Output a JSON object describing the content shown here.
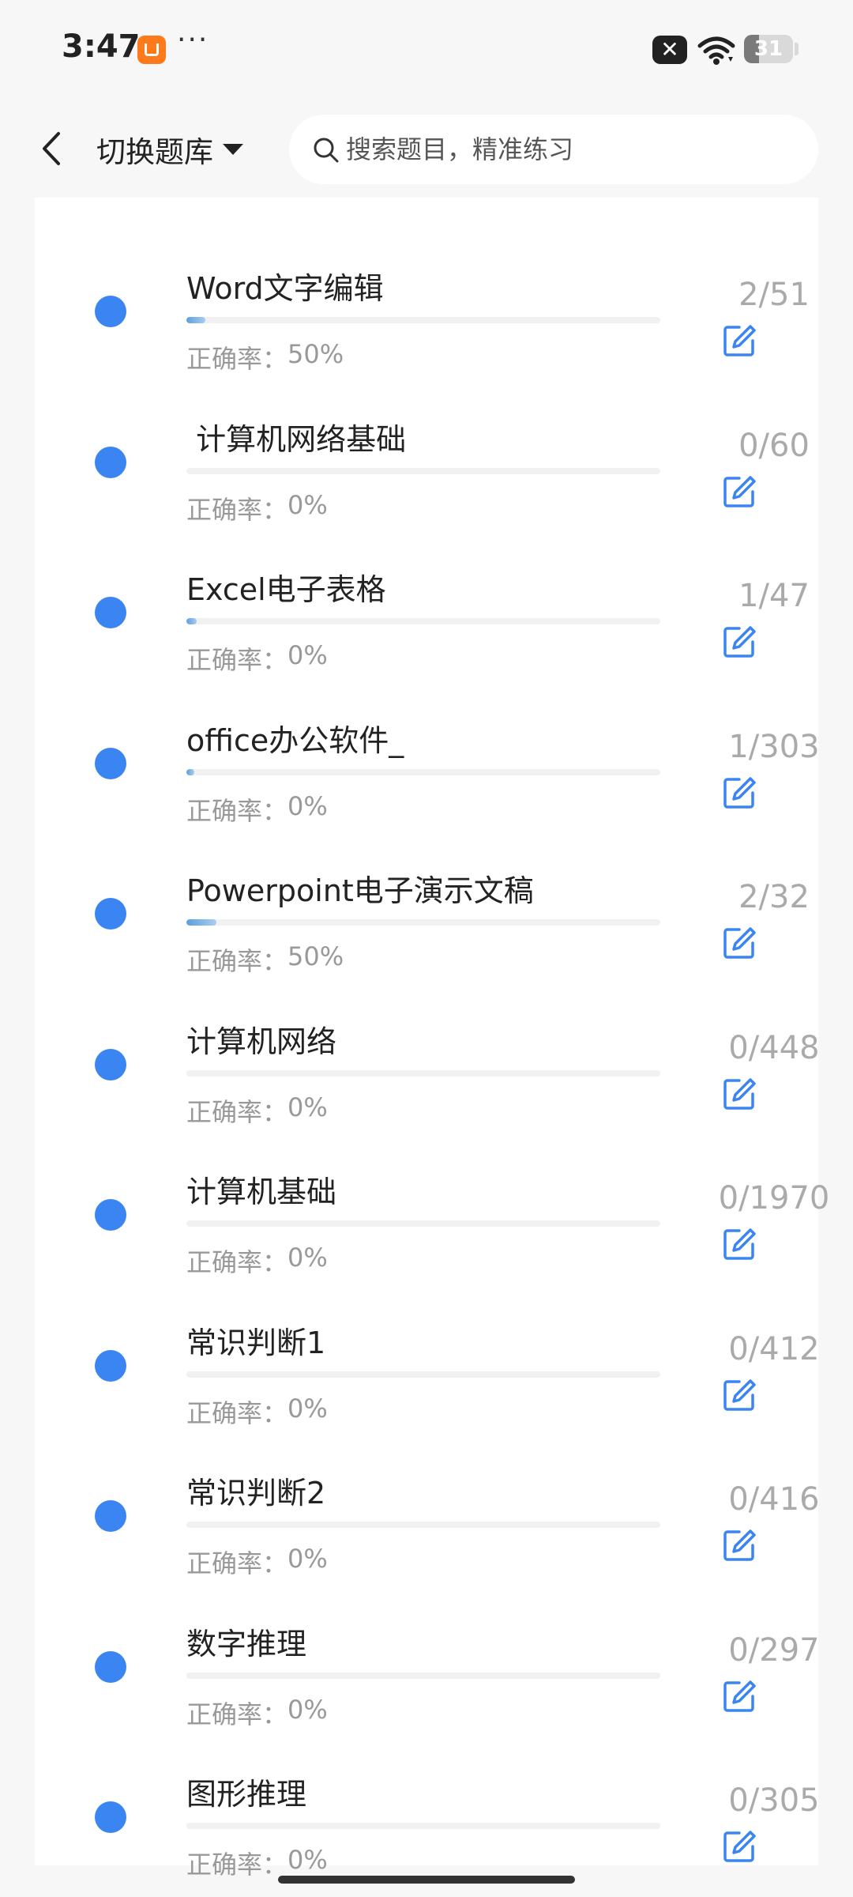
{
  "status_bar": {
    "time": "3:47",
    "more": "···",
    "battery": "31",
    "battery_level": 0.31,
    "icons": [
      "app-notification-icon",
      "mute-icon",
      "wifi-icon",
      "battery-icon"
    ]
  },
  "header": {
    "switch_label": "切换题库",
    "search_placeholder": "搜索题目，精准练习",
    "icons": [
      "back-arrow-icon",
      "caret-down-icon",
      "search-icon"
    ]
  },
  "accuracy_label": "正确率：",
  "colors": {
    "bullet": "#3a85f2",
    "edit_icon": "#3a85f2",
    "progress": "#5aa0dc",
    "count_text": "#aaaaaa",
    "accuracy_text": "#999999"
  },
  "items": [
    {
      "title": "Word文字编辑",
      "done": 2,
      "total": 51,
      "count": "2/51",
      "accuracy": "50%"
    },
    {
      "title": " 计算机网络基础",
      "done": 0,
      "total": 60,
      "count": "0/60",
      "accuracy": "0%"
    },
    {
      "title": "Excel电子表格",
      "done": 1,
      "total": 47,
      "count": "1/47",
      "accuracy": "0%"
    },
    {
      "title": "office办公软件_",
      "done": 1,
      "total": 303,
      "count": "1/303",
      "accuracy": "0%"
    },
    {
      "title": "Powerpoint电子演示文稿",
      "done": 2,
      "total": 32,
      "count": "2/32",
      "accuracy": "50%"
    },
    {
      "title": "计算机网络",
      "done": 0,
      "total": 448,
      "count": "0/448",
      "accuracy": "0%"
    },
    {
      "title": "计算机基础",
      "done": 0,
      "total": 1970,
      "count": "0/1970",
      "accuracy": "0%"
    },
    {
      "title": "常识判断1",
      "done": 0,
      "total": 412,
      "count": "0/412",
      "accuracy": "0%"
    },
    {
      "title": "常识判断2",
      "done": 0,
      "total": 416,
      "count": "0/416",
      "accuracy": "0%"
    },
    {
      "title": "数字推理",
      "done": 0,
      "total": 297,
      "count": "0/297",
      "accuracy": "0%"
    },
    {
      "title": "图形推理",
      "done": 0,
      "total": 305,
      "count": "0/305",
      "accuracy": "0%"
    }
  ]
}
